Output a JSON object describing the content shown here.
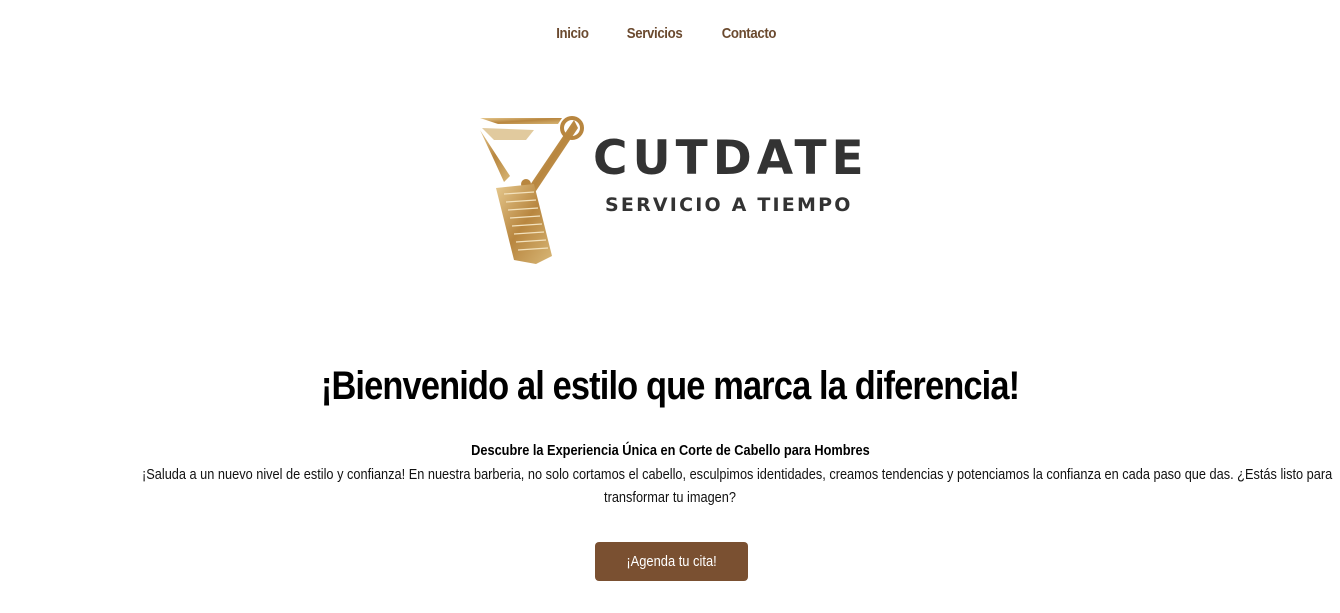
{
  "nav": {
    "items": [
      {
        "label": "Inicio"
      },
      {
        "label": "Servicios"
      },
      {
        "label": "Contacto"
      }
    ]
  },
  "logo": {
    "brand": "CUTDATE",
    "tagline": "SERVICIO A TIEMPO",
    "icon": "scissors-comb-icon"
  },
  "hero": {
    "title": "¡Bienvenido al estilo que marca la diferencia!",
    "subtitle": "Descubre la Experiencia Única en Corte de Cabello para Hombres",
    "description_line1": "¡Saluda a un nuevo nivel de estilo y confianza! En nuestra barberia, no solo cortamos el cabello, esculpimos identidades, creamos tendencias y potenciamos la confianza en cada paso que das. ¿Estás listo para",
    "description_line2": "transformar tu imagen?",
    "cta_label": "¡Agenda tu cita!"
  },
  "colors": {
    "accent": "#7a5031",
    "nav_text": "#6b4a2f",
    "gold": "#c49a52",
    "logo_text": "#333333"
  }
}
